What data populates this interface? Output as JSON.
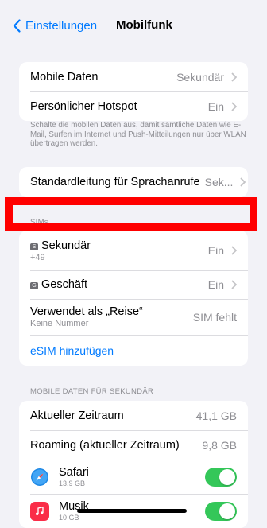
{
  "nav": {
    "back_label": "Einstellungen",
    "title": "Mobilfunk"
  },
  "group1": {
    "rows": [
      {
        "label": "Mobile Daten",
        "value": "Sekundär"
      },
      {
        "label": "Persönlicher Hotspot",
        "value": "Ein"
      }
    ],
    "footnote": "Schalte die mobilen Daten aus, damit sämtliche Daten wie E-Mail, Surfen im Internet und Push-Mitteilungen nur über WLAN übertragen werden."
  },
  "group2": {
    "label": "Standardleitung für Sprachanrufe",
    "value": "Sek..."
  },
  "sims": {
    "header": "SIMs",
    "rows": [
      {
        "label": "Sekundär",
        "sub": "+49",
        "value": "Ein",
        "badge": "S"
      },
      {
        "label": "Geschäft",
        "value": "Ein",
        "badge": "G"
      },
      {
        "label": "Verwendet als „Reise“",
        "sub": "Keine Nummer",
        "value": "SIM fehlt"
      }
    ],
    "add_esim": "eSIM hinzufügen"
  },
  "data_section": {
    "header": "MOBILE DATEN FÜR SEKUNDÄR",
    "rows": [
      {
        "label": "Aktueller Zeitraum",
        "value": "41,1 GB"
      },
      {
        "label": "Roaming (aktueller Zeitraum)",
        "value": "9,8 GB"
      }
    ],
    "apps": [
      {
        "name": "Safari",
        "size": "13,9 GB",
        "icon": "safari-icon",
        "enabled": true
      },
      {
        "name": "Musik",
        "size": "10 GB",
        "icon": "music-icon",
        "enabled": true
      }
    ]
  },
  "colors": {
    "accent": "#007aff",
    "toggle_on": "#34c759",
    "highlight": "#ff0000",
    "music_icon": "#fa2d48"
  }
}
